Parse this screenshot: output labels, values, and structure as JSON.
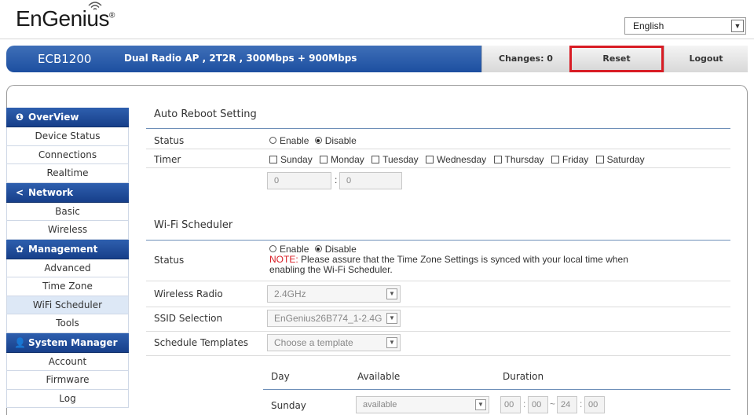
{
  "header": {
    "logo_text": "EnGenius",
    "logo_reg": "®",
    "language": "English",
    "dropdown_glyph": "▼"
  },
  "navbar": {
    "model": "ECB1200",
    "description": "Dual Radio AP , 2T2R , 300Mbps + 900Mbps",
    "changes": "Changes: 0",
    "reset": "Reset",
    "logout": "Logout"
  },
  "sidebar": {
    "sections": [
      {
        "title": "OverView",
        "icon": "info-icon",
        "glyph": "❶",
        "items": [
          "Device Status",
          "Connections",
          "Realtime"
        ]
      },
      {
        "title": "Network",
        "icon": "share-icon",
        "glyph": "<",
        "items": [
          "Basic",
          "Wireless"
        ]
      },
      {
        "title": "Management",
        "icon": "gear-icon",
        "glyph": "✿",
        "items": [
          "Advanced",
          "Time Zone",
          "WiFi Scheduler",
          "Tools"
        ]
      },
      {
        "title": "System Manager",
        "icon": "user-icon",
        "glyph": "👤",
        "items": [
          "Account",
          "Firmware",
          "Log"
        ]
      }
    ],
    "active_item": "WiFi Scheduler"
  },
  "auto_reboot": {
    "title": "Auto Reboot Setting",
    "status_label": "Status",
    "enable": "Enable",
    "disable": "Disable",
    "timer_label": "Timer",
    "days": [
      "Sunday",
      "Monday",
      "Tuesday",
      "Wednesday",
      "Thursday",
      "Friday",
      "Saturday"
    ],
    "hour_value": "0",
    "minute_value": "0",
    "separator": ":"
  },
  "wifi_scheduler": {
    "title": "Wi-Fi Scheduler",
    "status_label": "Status",
    "enable": "Enable",
    "disable": "Disable",
    "note_prefix": "NOTE:",
    "note_text": " Please assure that the Time Zone Settings is synced with your local time when",
    "note_text2": "enabling the Wi-Fi Scheduler.",
    "wireless_radio_label": "Wireless Radio",
    "wireless_radio_value": "2.4GHz",
    "ssid_label": "SSID Selection",
    "ssid_value": "EnGenius26B774_1-2.4G",
    "templates_label": "Schedule Templates",
    "templates_value": "Choose a template",
    "col_day": "Day",
    "col_available": "Available",
    "col_duration": "Duration",
    "row_day": "Sunday",
    "row_available": "available",
    "start_h": "00",
    "start_m": "00",
    "end_h": "24",
    "end_m": "00",
    "time_sep": ":",
    "range_sep": "~"
  }
}
